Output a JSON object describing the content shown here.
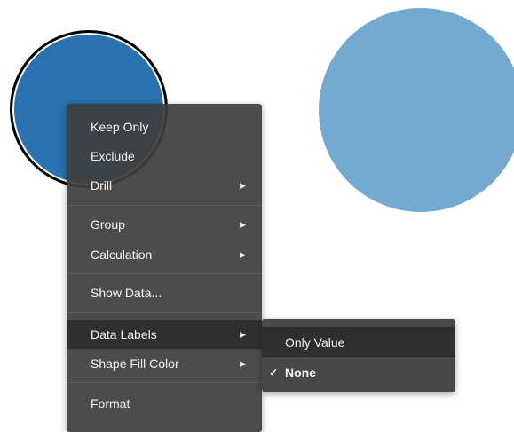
{
  "visual": {
    "left_circle_color": "#2a72b0",
    "right_circle_color": "#74aad2",
    "menu_bg": "#3e3e3e"
  },
  "context_menu": {
    "items": [
      {
        "label": "Keep Only"
      },
      {
        "label": "Exclude"
      },
      {
        "label": "Drill",
        "has_submenu": true,
        "arrow": "▶"
      },
      {
        "label": "Group",
        "has_submenu": true,
        "arrow": "▶"
      },
      {
        "label": "Calculation",
        "has_submenu": true,
        "arrow": "▶"
      },
      {
        "label": "Show Data..."
      },
      {
        "label": "Data Labels",
        "has_submenu": true,
        "arrow": "▶",
        "active": true
      },
      {
        "label": "Shape Fill Color",
        "has_submenu": true,
        "arrow": "▶"
      },
      {
        "label": "Format"
      }
    ]
  },
  "submenu": {
    "items": [
      {
        "label": "Only Value",
        "active": true
      },
      {
        "label": "None",
        "checked": true,
        "check_mark": "✓"
      }
    ]
  }
}
